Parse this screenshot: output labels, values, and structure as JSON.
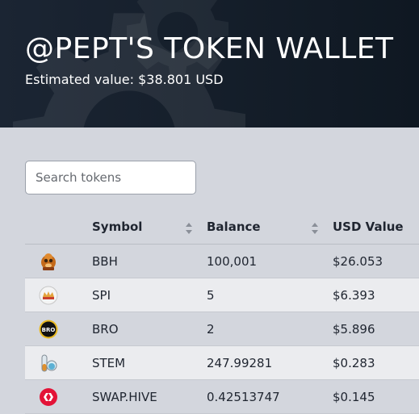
{
  "header": {
    "title": "@PEPT'S TOKEN WALLET",
    "estimated_value": "Estimated value: $38.801 USD"
  },
  "search": {
    "placeholder": "Search tokens",
    "value": ""
  },
  "table": {
    "columns": [
      "Symbol",
      "Balance",
      "USD Value"
    ],
    "rows": [
      {
        "icon": "bbh-token-icon",
        "symbol": "BBH",
        "balance": "100,001",
        "usd": "$26.053"
      },
      {
        "icon": "spi-token-icon",
        "symbol": "SPI",
        "balance": "5",
        "usd": "$6.393"
      },
      {
        "icon": "bro-token-icon",
        "symbol": "BRO",
        "balance": "2",
        "usd": "$5.896"
      },
      {
        "icon": "stem-token-icon",
        "symbol": "STEM",
        "balance": "247.99281",
        "usd": "$0.283"
      },
      {
        "icon": "hive-token-icon",
        "symbol": "SWAP.HIVE",
        "balance": "0.42513747",
        "usd": "$0.145"
      }
    ]
  },
  "colors": {
    "header_bg": "#141e2a",
    "page_bg": "#d3d6dd",
    "row_alt": "#ebecef",
    "hive_red": "#e31337"
  },
  "icons": {
    "bro_badge": "BRO"
  }
}
